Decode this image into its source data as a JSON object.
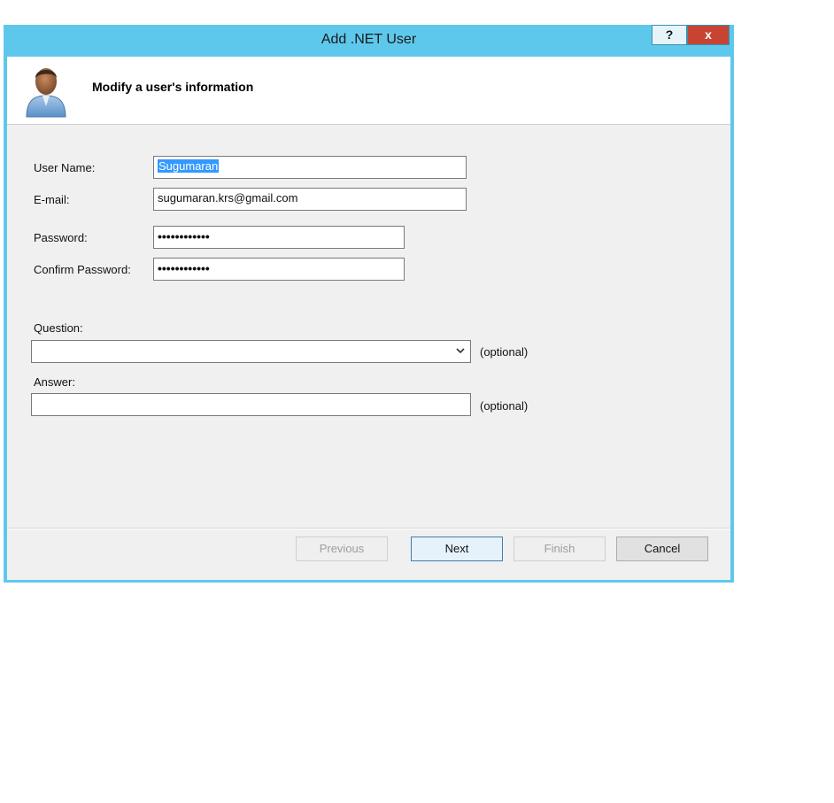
{
  "window": {
    "title": "Add .NET User",
    "help_label": "?",
    "close_label": "x"
  },
  "header": {
    "title": "Modify a user's information"
  },
  "form": {
    "username_label": "User Name:",
    "username_value": "Sugumaran",
    "email_label": "E-mail:",
    "email_value": "sugumaran.krs@gmail.com",
    "password_label": "Password:",
    "password_value": "••••••••••••",
    "confirm_label": "Confirm Password:",
    "confirm_value": "••••••••••••",
    "question_label": "Question:",
    "question_value": "",
    "question_hint": "(optional)",
    "answer_label": "Answer:",
    "answer_value": "",
    "answer_hint": "(optional)"
  },
  "buttons": {
    "previous": "Previous",
    "next": "Next",
    "finish": "Finish",
    "cancel": "Cancel"
  }
}
